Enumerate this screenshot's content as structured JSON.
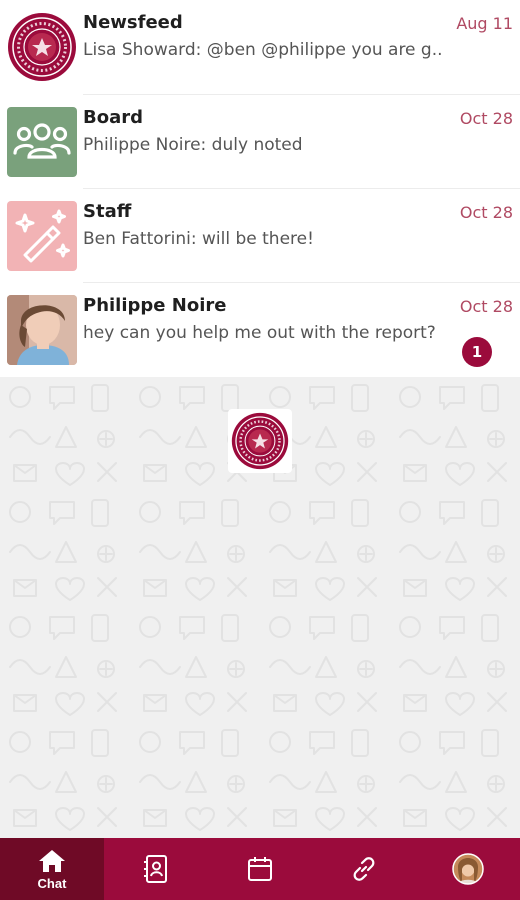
{
  "chats": [
    {
      "name": "Newsfeed",
      "preview": "Lisa Showard: @ben @philippe you are g...",
      "date": "Aug 11",
      "avatar": "seal-logo-icon",
      "unread": ""
    },
    {
      "name": "Board",
      "preview": "Philippe Noire: duly noted",
      "date": "Oct 28",
      "avatar": "group-people-icon",
      "unread": ""
    },
    {
      "name": "Staff",
      "preview": "Ben Fattorini: will be there!",
      "date": "Oct 28",
      "avatar": "magic-wand-icon",
      "unread": ""
    },
    {
      "name": "Philippe Noire",
      "preview": "hey can you help me out with the report?",
      "date": "Oct 28",
      "avatar": "user-photo",
      "unread": "1"
    }
  ],
  "tabs": [
    {
      "label": "Chat",
      "icon": "home-icon",
      "active": true
    },
    {
      "label": "",
      "icon": "contacts-icon",
      "active": false
    },
    {
      "label": "",
      "icon": "calendar-icon",
      "active": false
    },
    {
      "label": "",
      "icon": "link-icon",
      "active": false
    },
    {
      "label": "",
      "icon": "profile-avatar",
      "active": false
    }
  ],
  "colors": {
    "brand": "#9b0b3c",
    "brand_dark": "#6f0a26",
    "date": "#b04a63",
    "board_avatar": "#7aa17c",
    "staff_avatar": "#f2b3b5"
  }
}
